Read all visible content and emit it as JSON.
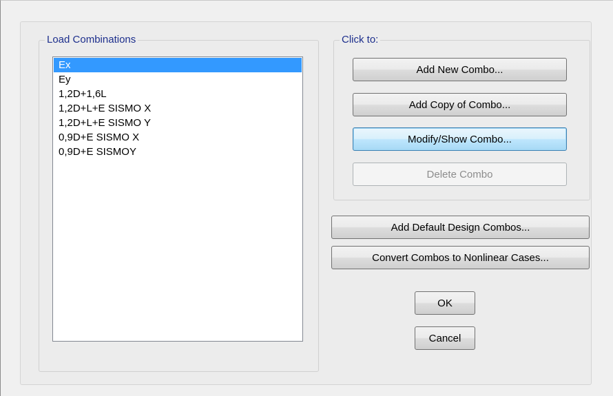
{
  "load_combinations": {
    "title": "Load Combinations",
    "items": [
      {
        "label": "Ex",
        "selected": true
      },
      {
        "label": "Ey",
        "selected": false
      },
      {
        "label": "1,2D+1,6L",
        "selected": false
      },
      {
        "label": "1,2D+L+E SISMO X",
        "selected": false
      },
      {
        "label": "1,2D+L+E SISMO Y",
        "selected": false
      },
      {
        "label": "0,9D+E SISMO X",
        "selected": false
      },
      {
        "label": "0,9D+E SISMOY",
        "selected": false
      }
    ]
  },
  "click_to": {
    "title": "Click to:",
    "add_new": "Add New Combo...",
    "add_copy": "Add Copy of Combo...",
    "modify_show": "Modify/Show Combo...",
    "delete": "Delete Combo"
  },
  "add_default": "Add Default Design Combos...",
  "convert": "Convert Combos to Nonlinear Cases...",
  "ok": "OK",
  "cancel": "Cancel",
  "colors": {
    "selection": "#3399ff",
    "group_title": "#1c2e8c",
    "disabled_text": "#8c8c8c"
  }
}
